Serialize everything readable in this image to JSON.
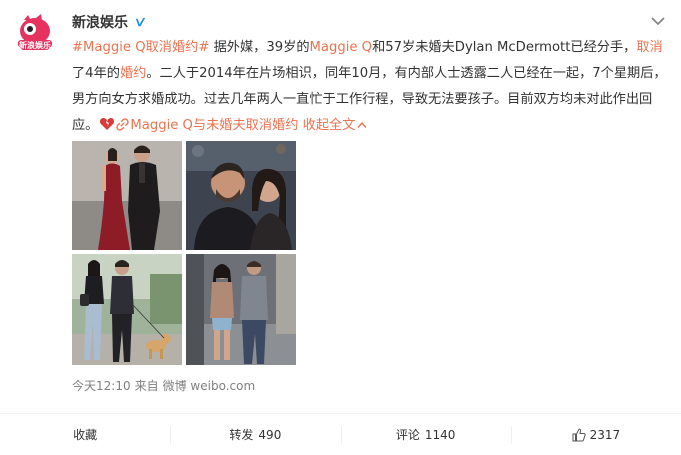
{
  "post": {
    "author": "新浪娱乐",
    "avatar_label": "新浪娱乐",
    "text_parts": {
      "tag": "#Maggie Q取消婚约#",
      "t1": " 据外媒，39岁的",
      "name1": "Maggie Q",
      "t2": "和57岁未婚夫Dylan McDermott已经分手，",
      "hl1": "取消",
      "t3": "了4年的",
      "hl2": "婚约",
      "t4": "。二人于2014年在片场相识，同年10月，有内部人士透露二人已经在一起，7个星期后，男方向女方求婚成功。过去几年两人一直忙于工作行程，导致无法要孩子。目前双方均未对此作出回应。",
      "link_text": "Maggie Q与未婚夫取消婚约",
      "collapse": "收起全文"
    },
    "time": "今天12:10",
    "from_label": "来自",
    "source": "微博 weibo.com"
  },
  "actions": {
    "favorite": "收藏",
    "repost_label": "转发",
    "repost_count": "490",
    "comment_label": "评论",
    "comment_count": "1140",
    "like_count": "2317"
  },
  "colors": {
    "accent": "#eb7350",
    "verified": "#1a8fe3",
    "text": "#333333",
    "meta": "#808080"
  },
  "icons": [
    "verified-icon",
    "chevron-down-icon",
    "broken-heart-icon",
    "link-icon",
    "chevron-up-icon",
    "thumbs-up-icon"
  ]
}
